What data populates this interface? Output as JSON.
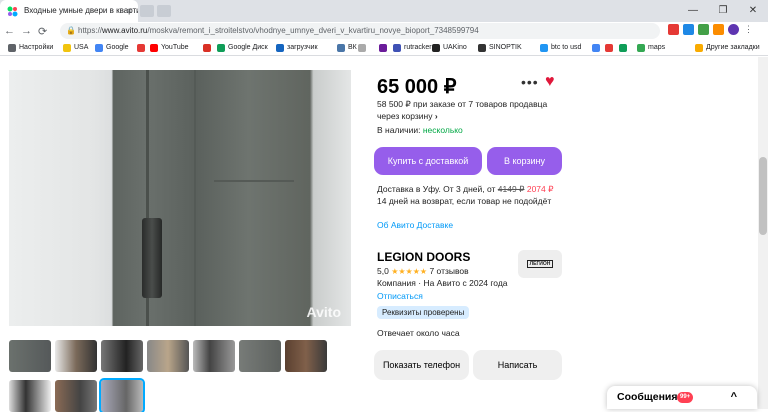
{
  "browser": {
    "tab_title": "Входные умные двери в квартиру",
    "tab_close": "×",
    "url_prefix": "https://",
    "url_host": "www.avito.ru",
    "url_path": "/moskva/remont_i_stroitelstvo/vhodnye_umnye_dveri_v_kvartiru_novye_bioport_7348599794",
    "window_controls": [
      "—",
      "❐",
      "✕"
    ],
    "nav": {
      "back": "←",
      "forward": "→",
      "reload": "⟳"
    },
    "bookmarks": [
      {
        "label": "Настройки",
        "color": "#5f6368"
      },
      {
        "label": "USA",
        "color": "#f1c40f"
      },
      {
        "label": "Google",
        "color": "#4285f4"
      },
      {
        "label": "",
        "color": "#e53935"
      },
      {
        "label": "YouTube",
        "color": "#ff0000"
      },
      {
        "label": "",
        "color": "#d93025"
      },
      {
        "label": "Google Диск",
        "color": "#0f9d58"
      },
      {
        "label": "загрузчик",
        "color": "#1565c0"
      },
      {
        "label": "ВК",
        "color": "#4a76a8"
      },
      {
        "label": "",
        "color": "#aaaaaa"
      },
      {
        "label": "",
        "color": "#6a1b9a"
      },
      {
        "label": "rutracker",
        "color": "#3f51b5"
      },
      {
        "label": "UAKino",
        "color": "#222222"
      },
      {
        "label": "SINOPTIK",
        "color": "#333333"
      },
      {
        "label": "btc to usd",
        "color": "#2196f3"
      },
      {
        "label": "",
        "color": "#4285f4"
      },
      {
        "label": "",
        "color": "#e53935"
      },
      {
        "label": "",
        "color": "#0f9d58"
      },
      {
        "label": "maps",
        "color": "#34a853"
      },
      {
        "label": "Другие закладки",
        "color": "#f9ab00"
      }
    ]
  },
  "listing": {
    "price": "65 000 ₽",
    "more_icon": "•••",
    "favorite_icon": "♥",
    "bulk_offer_line1": "58 500 ₽ при заказе от 7 товаров продавца",
    "bulk_offer_line2": "через корзину",
    "bulk_chevron": "›",
    "availability_label": "В наличии:",
    "availability_value": "несколько",
    "buy_delivery_button": "Купить с доставкой",
    "cart_button": "В корзину",
    "delivery_text": "Доставка в Уфу. От 3 дней, от",
    "delivery_old_price": "4149 ₽",
    "delivery_new_price": "2074 ₽",
    "return_text": "14 дней на возврат, если товар не подойдёт",
    "avito_delivery_link": "Об Авито Доставке",
    "watermark": "Avito",
    "thumbnails_count": 10
  },
  "seller": {
    "name": "LEGION DOORS",
    "logo_text": "ЛЕГИОН",
    "rating": "5,0",
    "stars": "★★★★★",
    "reviews": "7 отзывов",
    "meta": "Компания · На Авито с 2024 года",
    "unsubscribe": "Отписаться",
    "verified_badge": "Реквизиты проверены",
    "response_time": "Отвечает около часа",
    "show_phone_button": "Показать телефон",
    "write_button": "Написать"
  },
  "messages": {
    "label": "Сообщения",
    "badge": "99+",
    "chevron": "^"
  },
  "colors": {
    "accent_purple": "#965eeb",
    "green": "#02a845",
    "link_blue": "#0099f7",
    "heart_red": "#e0183b"
  }
}
